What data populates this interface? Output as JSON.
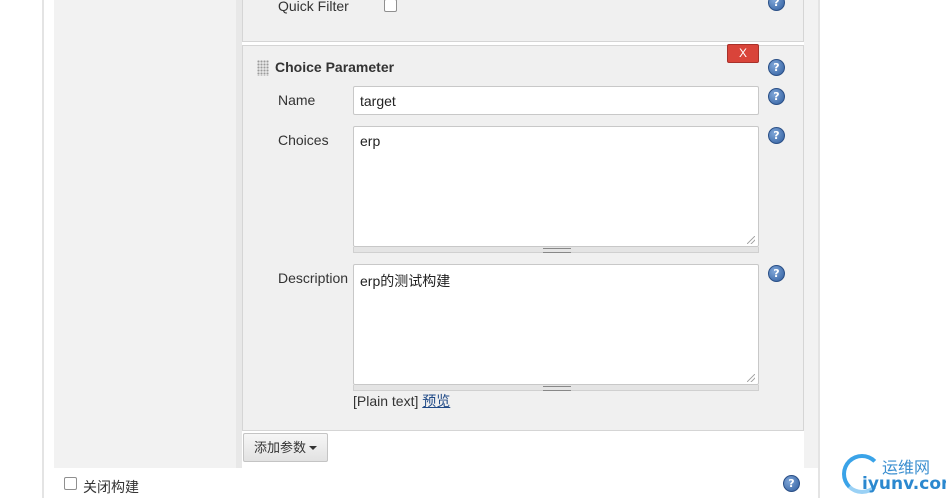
{
  "previous_parameter": {
    "quick_filter_label": "Quick Filter",
    "quick_filter_checked": false
  },
  "choice_parameter": {
    "title": "Choice Parameter",
    "delete_label": "X",
    "name_label": "Name",
    "name_value": "target",
    "choices_label": "Choices",
    "choices_value": "erp",
    "description_label": "Description",
    "description_value": "erp的测试构建",
    "plain_text_label": "[Plain text]",
    "preview_link": "预览"
  },
  "add_parameter_button": "添加参数",
  "disable_build_label": "关闭构建",
  "disable_build_checked": false,
  "help_icon_glyph": "?",
  "watermark": {
    "cn": "运维网",
    "en": "iyunv.com"
  },
  "colors": {
    "delete_button": "#d9443a",
    "help_icon": "#2f5d9e",
    "link": "#204a87",
    "panel_bg": "#f0f0f0"
  }
}
